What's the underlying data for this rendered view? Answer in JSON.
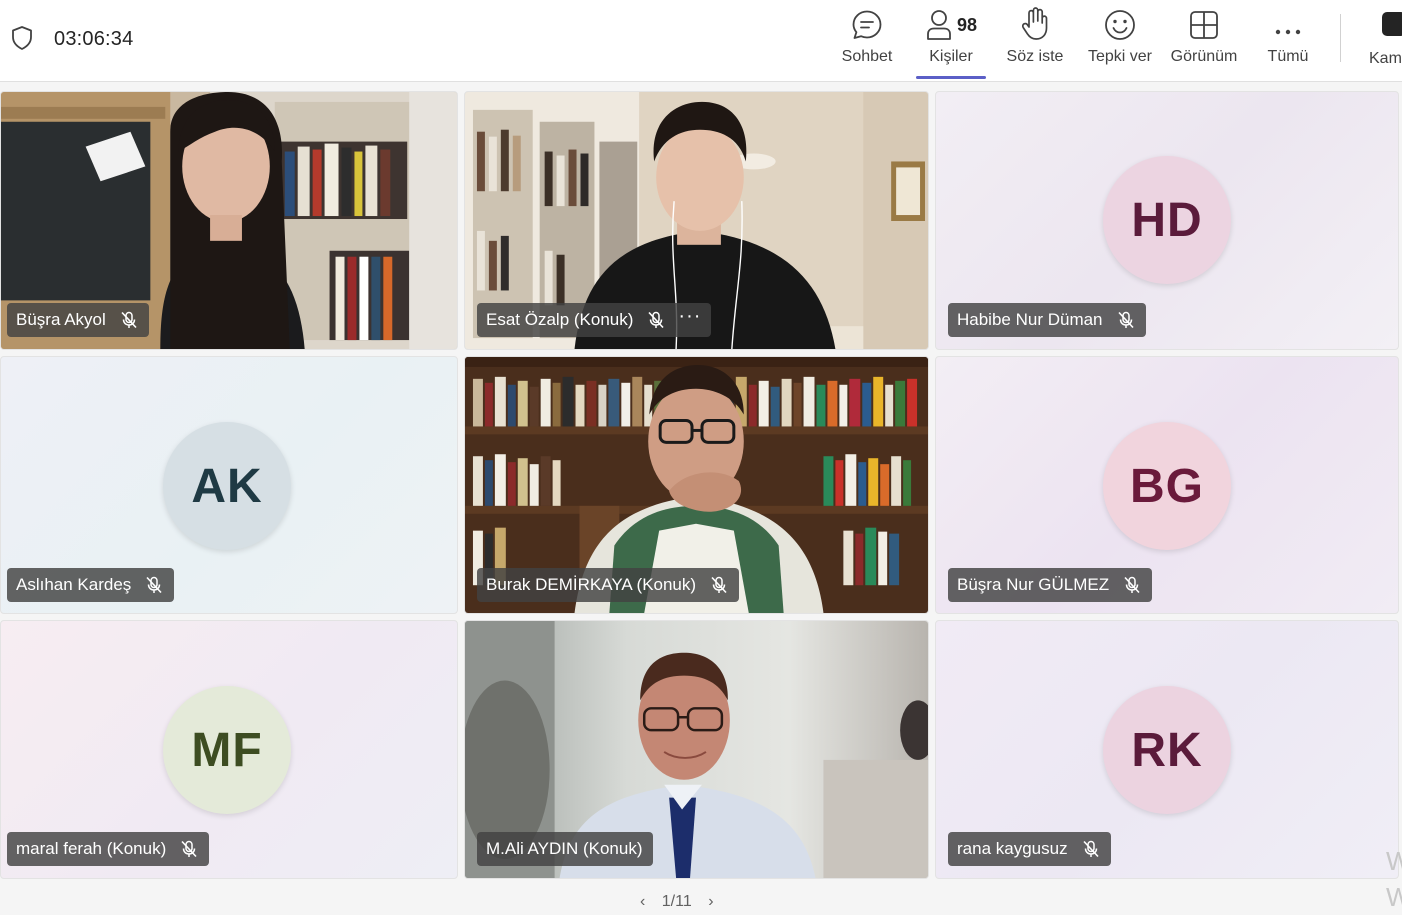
{
  "meeting": {
    "timer": "03:06:34"
  },
  "toolbar": {
    "chat_label": "Sohbet",
    "people_label": "Kişiler",
    "people_count": "98",
    "raise_hand_label": "Söz iste",
    "react_label": "Tepki ver",
    "view_label": "Görünüm",
    "more_label": "Tümü",
    "camera_label": "Kam"
  },
  "tiles": [
    {
      "name": "Büşra Akyol",
      "type": "video"
    },
    {
      "name": "Esat Özalp (Konuk)",
      "type": "video",
      "has_more": true
    },
    {
      "name": "Habibe Nur Düman",
      "type": "avatar",
      "initials": "HD",
      "avatar_bg": "#ecd4e1",
      "avatar_fg": "#5b1b3b"
    },
    {
      "name": "Aslıhan Kardeş",
      "type": "avatar",
      "initials": "AK",
      "avatar_bg": "#d6dfe4",
      "avatar_fg": "#1f3a44"
    },
    {
      "name": "Burak DEMİRKAYA (Konuk)",
      "type": "video"
    },
    {
      "name": "Büşra Nur GÜLMEZ",
      "type": "avatar",
      "initials": "BG",
      "avatar_bg": "#f1d4dd",
      "avatar_fg": "#6a1a3b"
    },
    {
      "name": "maral ferah (Konuk)",
      "type": "avatar",
      "initials": "MF",
      "avatar_bg": "#e4ead9",
      "avatar_fg": "#3d4d22"
    },
    {
      "name": "M.Ali AYDIN (Konuk)",
      "type": "video"
    },
    {
      "name": "rana kaygusuz",
      "type": "avatar",
      "initials": "RK",
      "avatar_bg": "#ecd3e0",
      "avatar_fg": "#5b1b3b"
    }
  ],
  "more_dots": "···",
  "pager": {
    "text": "1/11"
  },
  "watermark": "W\nW"
}
